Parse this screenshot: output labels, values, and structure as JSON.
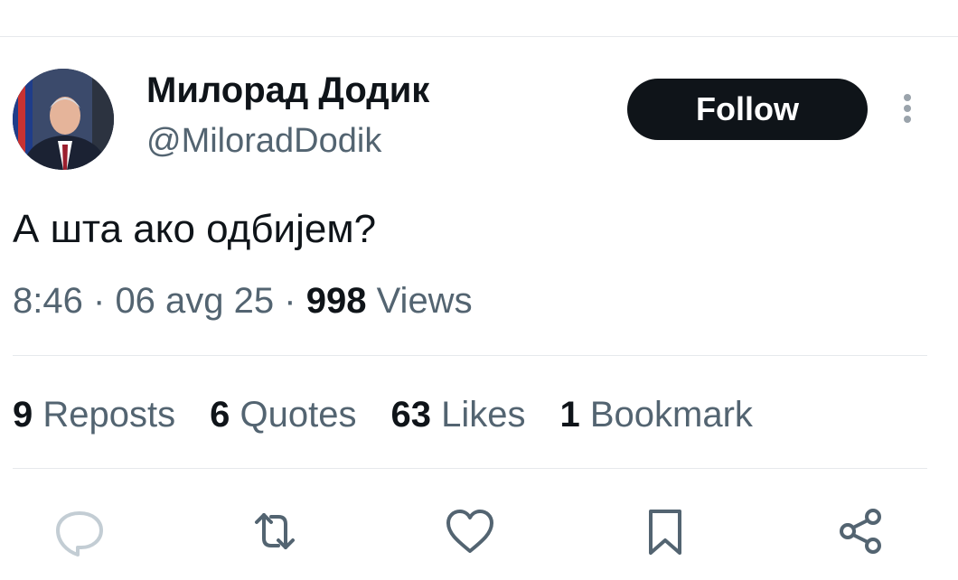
{
  "user": {
    "name": "Милорад Додик",
    "handle": "@MiloradDodik",
    "follow_label": "Follow"
  },
  "tweet": {
    "text": "А шта ако одбијем?",
    "time": "8:46",
    "date": "06 avg 25",
    "separator": "·",
    "views_count": "998",
    "views_label": "Views"
  },
  "stats": [
    {
      "count": "9",
      "label": "Reposts"
    },
    {
      "count": "6",
      "label": "Quotes"
    },
    {
      "count": "63",
      "label": "Likes"
    },
    {
      "count": "1",
      "label": "Bookmark"
    }
  ],
  "actions": [
    {
      "icon": "reply-icon"
    },
    {
      "icon": "repost-icon"
    },
    {
      "icon": "like-icon"
    },
    {
      "icon": "bookmark-icon"
    },
    {
      "icon": "share-icon"
    }
  ],
  "colors": {
    "text_primary": "#0f1419",
    "text_secondary": "#536471",
    "divider": "#e6e9ec",
    "follow_bg": "#0f1419",
    "follow_text": "#ffffff"
  }
}
